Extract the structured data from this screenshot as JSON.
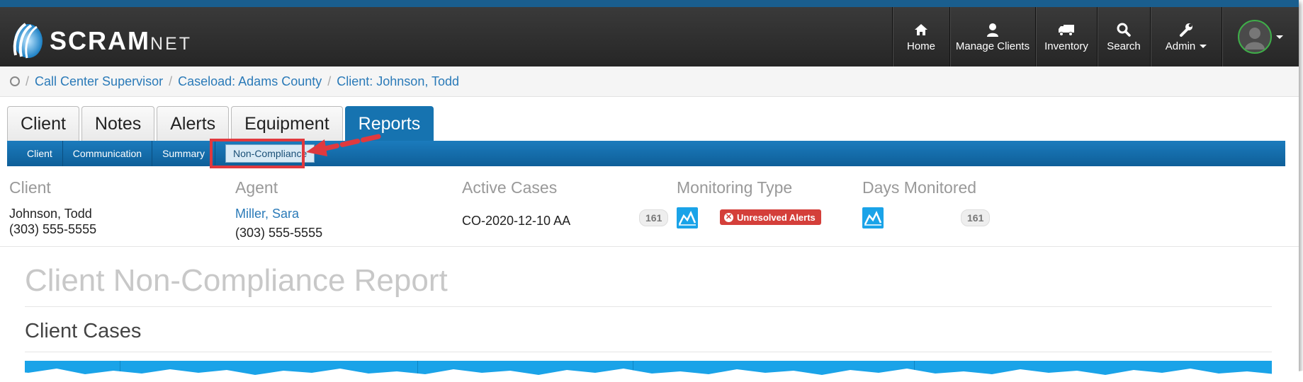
{
  "brand": {
    "name_main": "SCRAM",
    "name_suffix": "NET"
  },
  "nav": [
    {
      "label": "Home",
      "icon": "home-icon"
    },
    {
      "label": "Manage Clients",
      "icon": "user-icon"
    },
    {
      "label": "Inventory",
      "icon": "truck-icon"
    },
    {
      "label": "Search",
      "icon": "search-icon"
    },
    {
      "label": "Admin",
      "icon": "wrench-icon"
    }
  ],
  "breadcrumb": {
    "items": [
      "Call Center Supervisor",
      "Caseload: Adams County",
      "Client: Johnson, Todd"
    ],
    "separator": "/"
  },
  "tabs": [
    "Client",
    "Notes",
    "Alerts",
    "Equipment",
    "Reports"
  ],
  "active_tab": "Reports",
  "subtabs": [
    "Client",
    "Communication",
    "Summary",
    "Non-Compliance"
  ],
  "active_subtab": "Non-Compliance",
  "client_info": {
    "client": {
      "label": "Client",
      "name": "Johnson, Todd",
      "phone": "(303) 555-5555"
    },
    "agent": {
      "label": "Agent",
      "name": "Miller, Sara",
      "phone": "(303) 555-5555"
    },
    "active_cases": {
      "label": "Active Cases",
      "case": "CO-2020-12-10 AA",
      "count": "161"
    },
    "monitoring_type": {
      "label": "Monitoring Type",
      "alert": "Unresolved Alerts"
    },
    "days_monitored": {
      "label": "Days Monitored",
      "count": "161"
    }
  },
  "report": {
    "title": "Client Non-Compliance Report",
    "section": "Client Cases"
  },
  "colors": {
    "accent": "#1673b0",
    "highlight": "#e0393e",
    "alert": "#d43f3a",
    "monitor": "#1aa3e8"
  }
}
